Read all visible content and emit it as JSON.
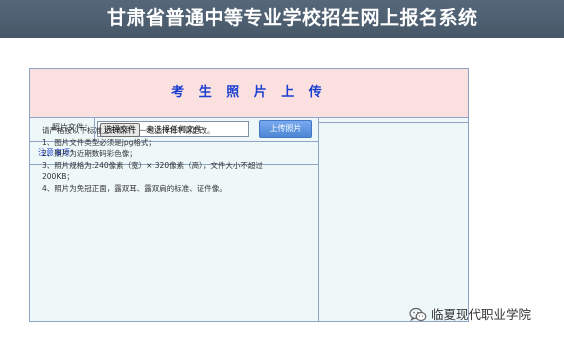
{
  "header": {
    "title": "甘肃省普通中等专业学校招生网上报名系统"
  },
  "panel": {
    "title": "考 生 照 片 上 传",
    "upload": {
      "label": "照片文件：",
      "choose_button": "选择文件",
      "file_status": "未选择任何文件",
      "submit_button": "上传照片"
    },
    "notice": {
      "title": "注意事项：",
      "lines": [
        "请严格按以下标准上传照片，一经上传将不得更改。",
        "1、图片文件类型必须是jpg格式；",
        "2、照片为近期数码彩色像；",
        "3、照片规格为:240像素（宽）× 320像素（高），文件大小不超过",
        "200KB；",
        "4、照片为免冠正面，露双耳、露双肩的标准、证件像。"
      ]
    }
  },
  "watermark": {
    "icon": "wechat-icon",
    "text": "临夏现代职业学院"
  },
  "colors": {
    "header_bg": "#4c5e6e",
    "panel_head_bg": "#fbe0e0",
    "panel_bg": "#eef8f8",
    "accent_blue": "#1a3fd1",
    "button_blue": "#5a94de",
    "border": "#8fa3c9"
  }
}
